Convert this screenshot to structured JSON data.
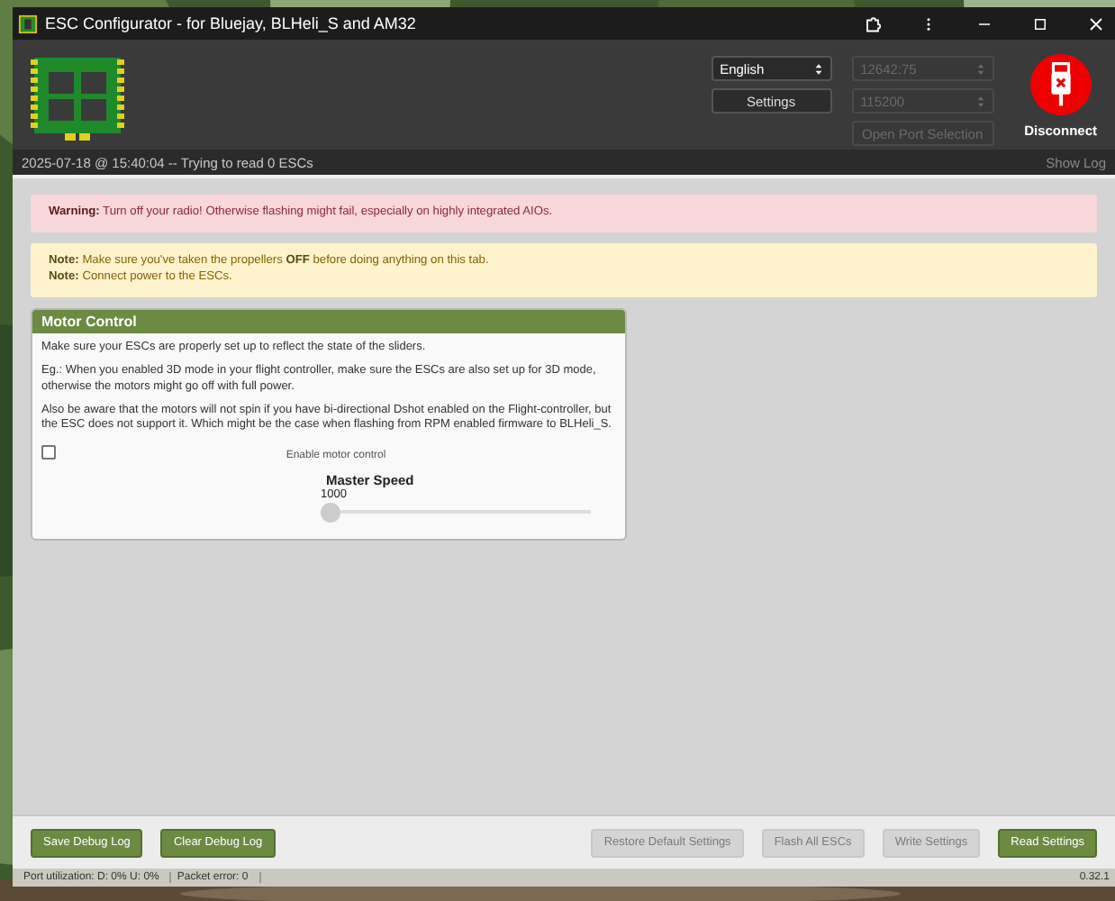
{
  "window": {
    "title": "ESC Configurator - for Bluejay, BLHeli_S and AM32"
  },
  "header": {
    "language": {
      "value": "English",
      "disabled": false
    },
    "settings_button": {
      "label": "Settings",
      "disabled": false
    },
    "port": {
      "value": "12642:75",
      "disabled": true
    },
    "baud": {
      "value": "115200",
      "disabled": true
    },
    "open_port_button": {
      "label": "Open Port Selection",
      "disabled": true
    },
    "disconnect_button": {
      "label": "Disconnect"
    }
  },
  "log_bar": {
    "message": "2025-07-18 @ 15:40:04 -- Trying to read 0 ESCs",
    "show_log": "Show Log"
  },
  "alerts": [
    {
      "kind": "warning",
      "lines": [
        "**Warning:** Turn off your radio! Otherwise flashing might fail, especially on highly integrated AIOs."
      ]
    },
    {
      "kind": "note",
      "lines": [
        "**Note:** Make sure you've taken the propellers **OFF** before doing anything on this tab.",
        "**Note:** Connect power to the ESCs."
      ]
    }
  ],
  "motor_control": {
    "title": "Motor Control",
    "paragraphs": [
      "Make sure your ESCs are properly set up to reflect the state of the sliders.",
      "Eg.: When you enabled 3D mode in your flight controller, make sure the ESCs are also set up for 3D mode, otherwise the motors might go off with full power.",
      "Also be aware that the motors will not spin if you have bi-directional Dshot enabled on the Flight-controller, but the ESC does not support it. Which might be the case when flashing from RPM enabled firmware to BLHeli_S."
    ],
    "enable": {
      "label": "Enable motor control",
      "checked": false
    },
    "master_speed": {
      "title": "Master Speed",
      "value": "1000",
      "level": 0
    }
  },
  "footer_left_buttons": [
    {
      "label": "Save Debug Log",
      "disabled": false
    },
    {
      "label": "Clear Debug Log",
      "disabled": false
    }
  ],
  "footer_right_buttons": [
    {
      "label": "Restore Default Settings",
      "disabled": true
    },
    {
      "label": "Flash All ESCs",
      "disabled": true
    },
    {
      "label": "Write Settings",
      "disabled": true
    },
    {
      "label": "Read Settings",
      "disabled": false
    }
  ],
  "status_bar": {
    "port_utilization": "Port utilization: D: 0% U: 0%",
    "packet_error": "Packet error: 0",
    "version": "0.32.1"
  }
}
